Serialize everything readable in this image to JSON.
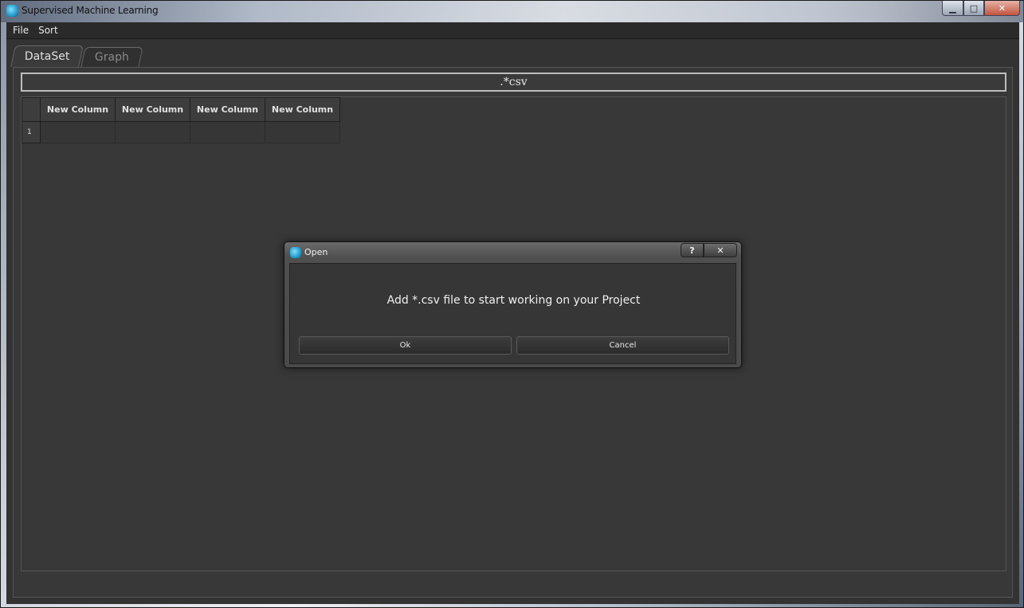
{
  "window": {
    "title": "Supervised Machine Learning",
    "controls": {
      "minimize": "▁",
      "maximize": "□",
      "close": "✕"
    }
  },
  "menubar": {
    "items": [
      {
        "label": "File"
      },
      {
        "label": "Sort"
      }
    ]
  },
  "tabs": [
    {
      "label": "DataSet",
      "active": true
    },
    {
      "label": "Graph",
      "active": false
    }
  ],
  "dataset": {
    "file_field": ".*csv",
    "table": {
      "columns": [
        "New Column",
        "New Column",
        "New Column",
        "New Column"
      ],
      "rows": [
        {
          "index": "1",
          "cells": [
            "",
            "",
            "",
            ""
          ]
        }
      ]
    }
  },
  "dialog": {
    "title": "Open",
    "help_label": "?",
    "close_label": "✕",
    "message": "Add *.csv file to start working on your Project",
    "ok_label": "Ok",
    "cancel_label": "Cancel"
  }
}
